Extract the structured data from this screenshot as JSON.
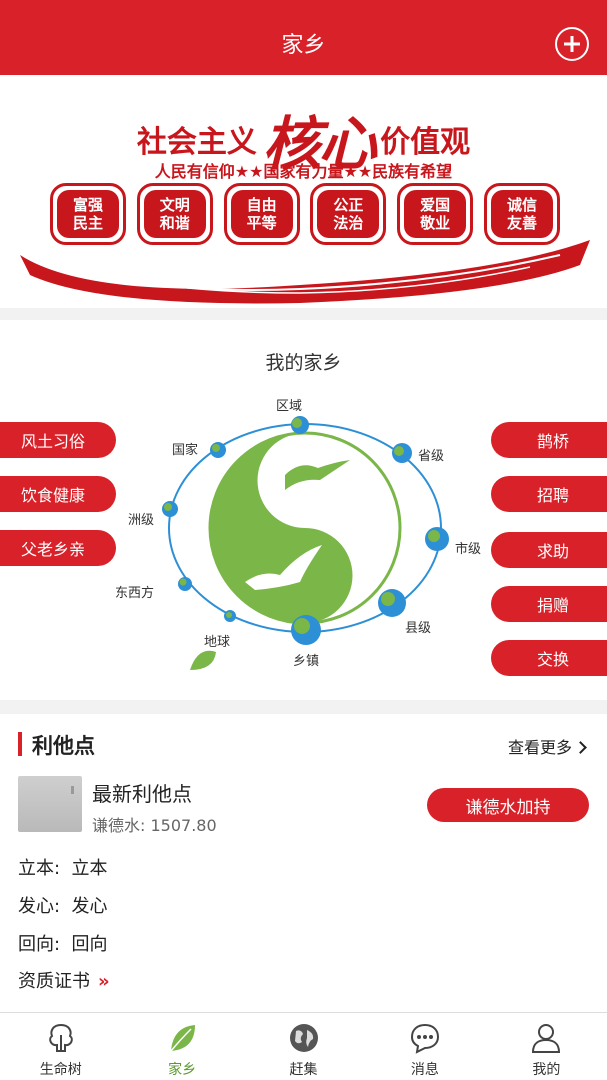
{
  "header": {
    "title": "家乡"
  },
  "banner": {
    "slogan_left": "社会主义",
    "slogan_core": "核心",
    "slogan_right": "价值观",
    "subtitle": "人民有信仰★★国家有力量★★民族有希望",
    "values": [
      {
        "line1": "富强",
        "line2": "民主"
      },
      {
        "line1": "文明",
        "line2": "和谐"
      },
      {
        "line1": "自由",
        "line2": "平等"
      },
      {
        "line1": "公正",
        "line2": "法治"
      },
      {
        "line1": "爱国",
        "line2": "敬业"
      },
      {
        "line1": "诚信",
        "line2": "友善"
      }
    ],
    "accent_color": "#c8161d"
  },
  "hometown": {
    "title": "我的家乡",
    "left_buttons": [
      "风土习俗",
      "饮食健康",
      "父老乡亲"
    ],
    "right_buttons": [
      "鹊桥",
      "招聘",
      "求助",
      "捐赠",
      "交换"
    ],
    "nodes": {
      "region": "区域",
      "province": "省级",
      "country": "国家",
      "continent": "洲级",
      "city": "市级",
      "hemisphere": "东西方",
      "county": "县级",
      "earth": "地球",
      "town": "乡镇"
    },
    "yin_color": "#7ab648",
    "orbit_color": "#2d8fd5"
  },
  "benefit": {
    "title": "利他点",
    "more_label": "查看更多",
    "item_title": "最新利他点",
    "water_label": "谦德水:",
    "water_value": "1507.80",
    "support_button": "谦德水加持",
    "rows": [
      {
        "key": "立本:",
        "value": "立本"
      },
      {
        "key": "发心:",
        "value": "发心"
      },
      {
        "key": "回向:",
        "value": "回向"
      }
    ],
    "cert_label": "资质证书",
    "cert_arrows": "»"
  },
  "tabbar": {
    "tabs": [
      {
        "label": "生命树",
        "icon": "tree-icon"
      },
      {
        "label": "家乡",
        "icon": "leaf-icon"
      },
      {
        "label": "赶集",
        "icon": "globe-icon"
      },
      {
        "label": "消息",
        "icon": "chat-icon"
      },
      {
        "label": "我的",
        "icon": "user-icon"
      }
    ],
    "active_color": "#5a9a2e",
    "brand_color": "#d9212a"
  }
}
